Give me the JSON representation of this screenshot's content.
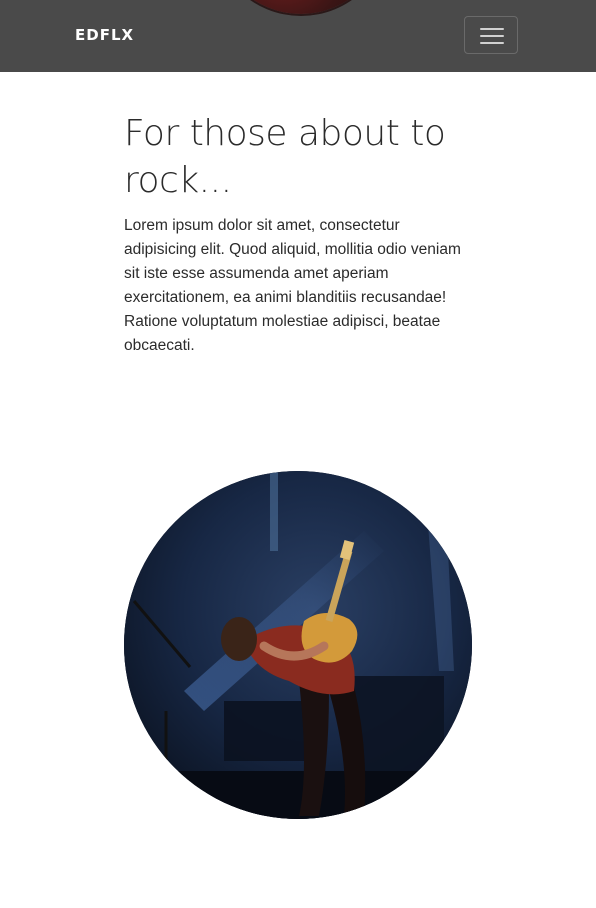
{
  "navbar": {
    "brand": "EDFLX",
    "toggler_icon": "hamburger-menu-icon"
  },
  "main": {
    "heading": "For those about to rock...",
    "paragraph": "Lorem ipsum dolor sit amet, consectetur adipisicing elit. Quod aliquid, mollitia odio veniam sit iste esse assumenda amet aperiam exercitationem, ea animi blanditiis recusandae! Ratione voluptatum molestiae adipisci, beatae obcaecati."
  },
  "colors": {
    "navbar_bg": "#4a4a4a",
    "text": "#2b2b2b",
    "page_bg": "#ffffff"
  }
}
